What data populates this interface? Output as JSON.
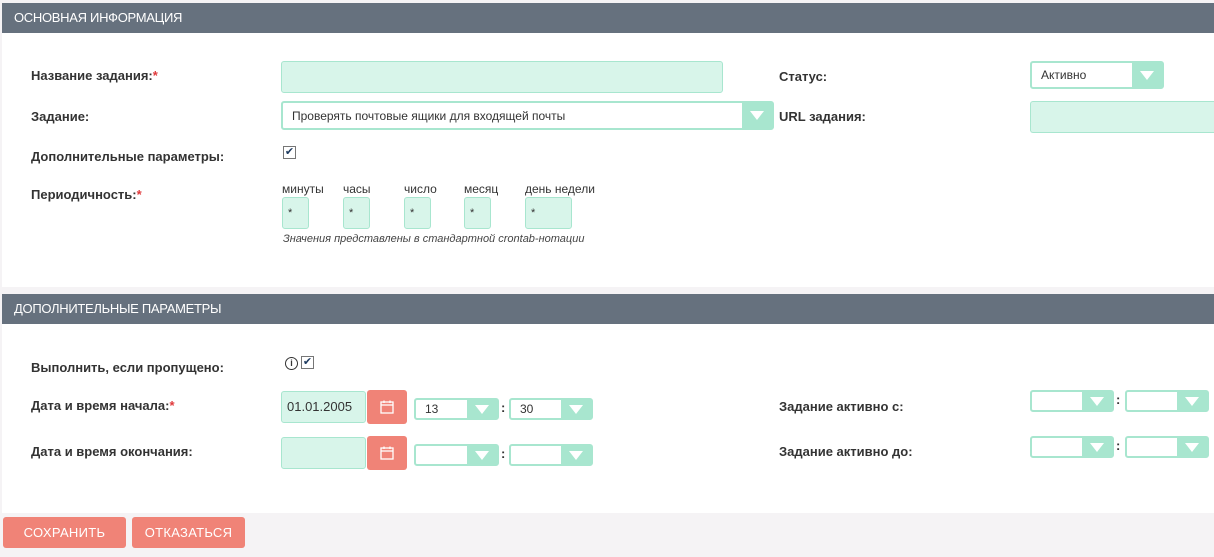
{
  "section_main": {
    "title": "ОСНОВНАЯ ИНФОРМАЦИЯ",
    "name_label": "Название задания:",
    "name_value": "",
    "job_label": "Задание:",
    "job_value": "Проверять почтовые ящики для входящей почты",
    "advanced_label": "Дополнительные параметры:",
    "advanced_checked": true,
    "period_label": "Периодичность:",
    "status_label": "Статус:",
    "status_value": "Активно",
    "url_label": "URL задания:",
    "url_value": "",
    "required_mark": "*"
  },
  "cron": {
    "fields": [
      {
        "label": "минуты",
        "value": "*"
      },
      {
        "label": "часы",
        "value": "*"
      },
      {
        "label": "число",
        "value": "*"
      },
      {
        "label": "месяц",
        "value": "*"
      },
      {
        "label": "день недели",
        "value": "*"
      }
    ],
    "hint": "Значения представлены в стандартной crontab-нотации"
  },
  "section_extra": {
    "title": "ДОПОЛНИТЕЛЬНЫЕ ПАРАМЕТРЫ",
    "catchup_label": "Выполнить, если пропущено:",
    "catchup_checked": true,
    "start_label": "Дата и время начала:",
    "start_date": "01.01.2005",
    "start_hour": "13",
    "start_minute": "30",
    "end_label": "Дата и время окончания:",
    "end_date": "",
    "end_hour": "",
    "end_minute": "",
    "active_from_label": "Задание активно с:",
    "active_to_label": "Задание активно до:",
    "time_separator": ":"
  },
  "buttons": {
    "save": "СОХРАНИТЬ",
    "cancel": "ОТКАЗАТЬСЯ"
  },
  "colors": {
    "header": "#66717e",
    "field_bg": "#d8f5ea",
    "field_border": "#a8e6cf",
    "accent": "#f08377",
    "required": "#e0393b"
  }
}
